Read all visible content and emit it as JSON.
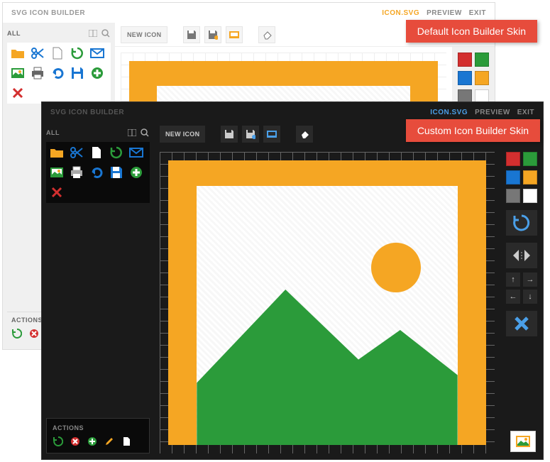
{
  "app_title": "SVG ICON BUILDER",
  "header_links": {
    "active": "ICON.SVG",
    "preview": "PREVIEW",
    "exit": "EXIT"
  },
  "sidebar": {
    "title": "ALL"
  },
  "toolbar": {
    "new_icon": "NEW ICON"
  },
  "actions": {
    "title": "ACTIONS"
  },
  "badges": {
    "default": "Default Icon Builder Skin",
    "custom": "Custom Icon Builder Skin"
  },
  "swatches": {
    "row1": [
      "#d32f2f",
      "#2b9b3a"
    ],
    "row2": [
      "#1976d2",
      "#f5a623"
    ],
    "row3": [
      "#777",
      "#fff"
    ]
  },
  "icons": [
    "folder",
    "scissors",
    "file",
    "refresh",
    "mail",
    "image",
    "print",
    "undo",
    "save",
    "add",
    "close"
  ],
  "actions_light": [
    "refresh",
    "delete"
  ],
  "actions_dark": [
    "refresh",
    "delete",
    "add",
    "edit",
    "file"
  ]
}
